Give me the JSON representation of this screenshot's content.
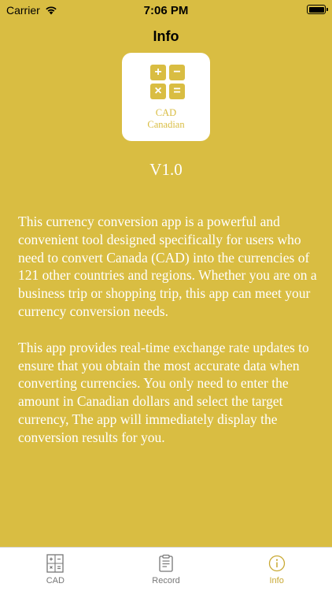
{
  "status_bar": {
    "carrier": "Carrier",
    "time": "7:06 PM"
  },
  "nav": {
    "title": "Info"
  },
  "app_icon": {
    "symbols": [
      "+",
      "−",
      "×",
      "="
    ],
    "code": "CAD",
    "name": "Canadian"
  },
  "version": "V1.0",
  "description": {
    "paragraph1": "This currency conversion app is a powerful and convenient tool designed specifically for users who need to convert Canada (CAD) into the currencies of 121 other countries and regions. Whether you are on a business trip or shopping trip, this app can meet your currency conversion needs.",
    "paragraph2": "This app provides real-time exchange rate updates to ensure that you obtain the most accurate data when converting currencies. You only need to enter the amount in Canadian dollars and select the target currency, The app will immediately display the conversion results for you."
  },
  "tabs": [
    {
      "label": "CAD",
      "icon": "calculator-icon",
      "active": false
    },
    {
      "label": "Record",
      "icon": "clipboard-icon",
      "active": false
    },
    {
      "label": "Info",
      "icon": "info-icon",
      "active": true
    }
  ],
  "colors": {
    "background": "#d9bd42",
    "accent": "#c9a933",
    "tab_inactive": "#777777"
  }
}
